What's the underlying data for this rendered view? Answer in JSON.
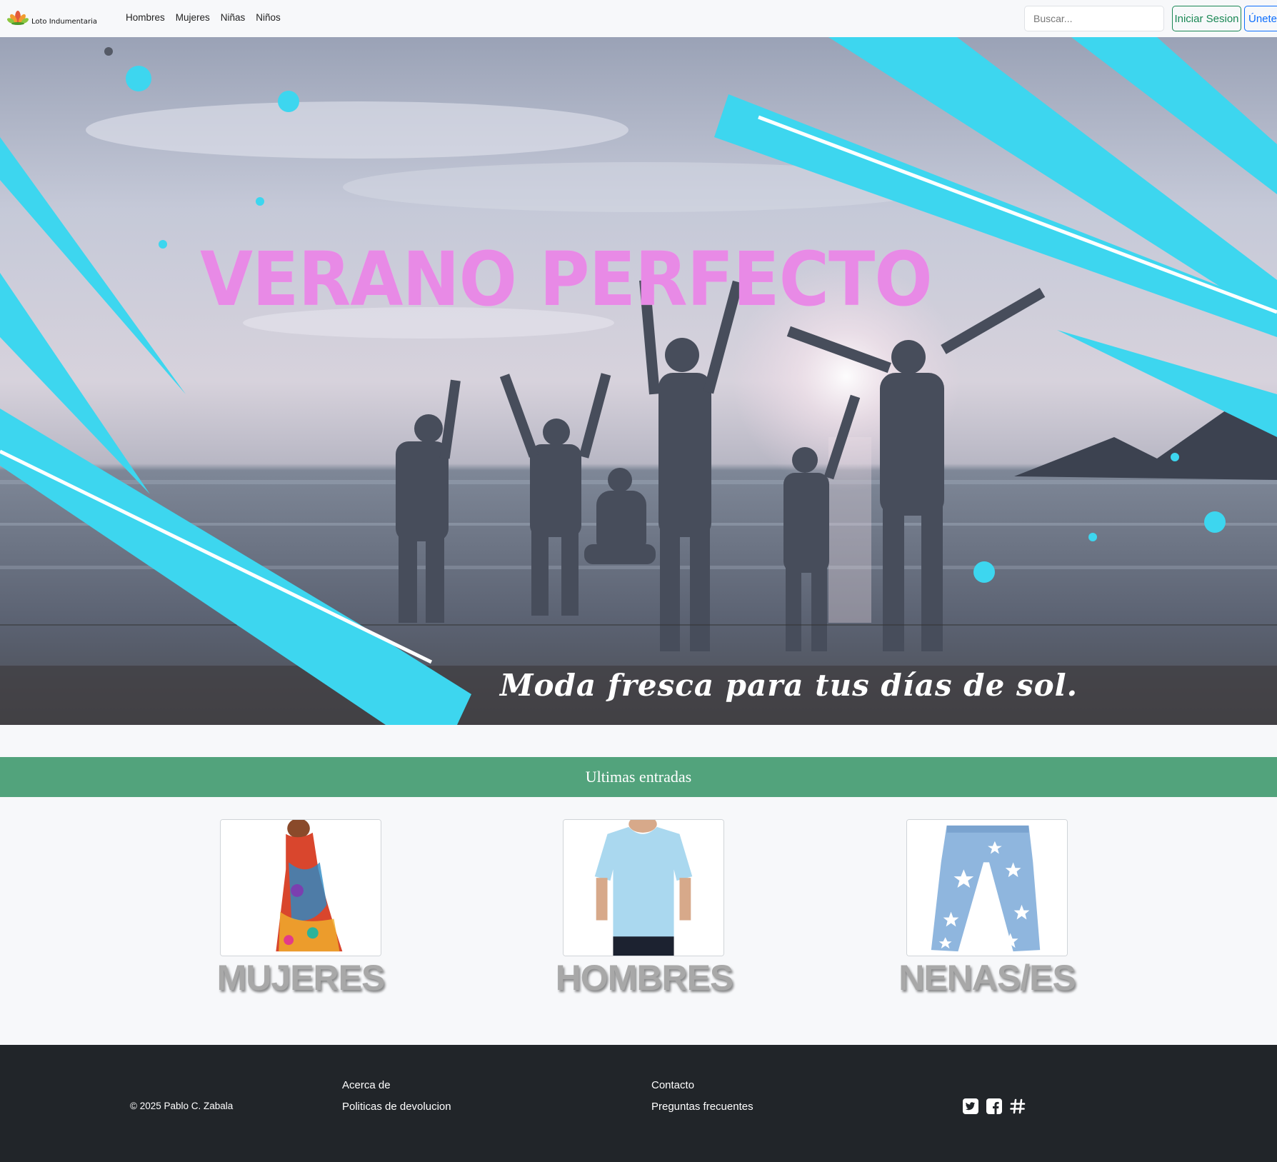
{
  "brand": {
    "name": "Loto Indumentaria",
    "logo_icon": "lotus-icon"
  },
  "nav": {
    "links": [
      "Hombres",
      "Mujeres",
      "Niñas",
      "Niños"
    ]
  },
  "search": {
    "placeholder": "Buscar..."
  },
  "auth": {
    "login_label": "Iniciar Sesion",
    "join_label": "Únete"
  },
  "hero": {
    "title": "VERANO PERFECTO",
    "subtitle": "Moda fresca  para tus días de sol.",
    "accent_color": "#3dd6ef"
  },
  "latest": {
    "heading": "Ultimas entradas",
    "categories": [
      {
        "label": "MUJERES",
        "image_icon": "dress-image"
      },
      {
        "label": "HOMBRES",
        "image_icon": "tshirt-image"
      },
      {
        "label": "NENAS/ES",
        "image_icon": "jeans-image"
      }
    ]
  },
  "footer": {
    "copyright": "© 2025 Pablo C. Zabala",
    "col1": [
      "Acerca de",
      "Politicas de devolucion"
    ],
    "col2": [
      "Contacto",
      "Preguntas frecuentes"
    ],
    "socials": [
      "twitter-icon",
      "facebook-icon",
      "hashtag-icon"
    ]
  },
  "colors": {
    "success": "#198754",
    "primary": "#0d6efd",
    "banner": "#52a37c",
    "footer_bg": "#212529"
  }
}
